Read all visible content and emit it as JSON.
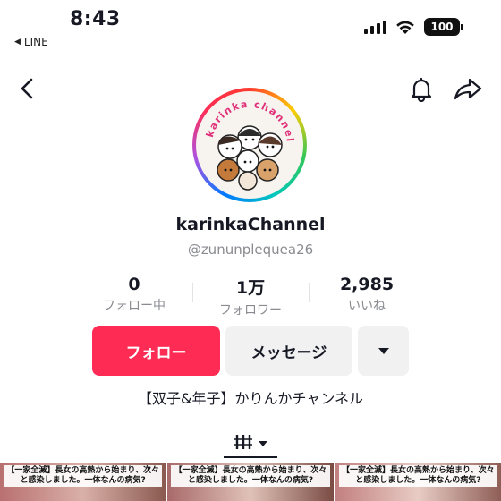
{
  "status_bar": {
    "time": "8:43",
    "back_app": "LINE",
    "battery": "100"
  },
  "profile": {
    "avatar_text": "karinka channel",
    "username": "karinkaChannel",
    "handle": "@zununplequea26",
    "bio": "【双子&年子】かりんかチャンネル"
  },
  "stats": {
    "following": {
      "value": "0",
      "label": "フォロー中"
    },
    "followers": {
      "value": "1万",
      "label": "フォロワー"
    },
    "likes": {
      "value": "2,985",
      "label": "いいね"
    }
  },
  "actions": {
    "follow": "フォロー",
    "message": "メッセージ"
  },
  "videos": [
    {
      "caption": "【一家全滅】長女の高熱から始まり、次々と感染しました。一体なんの病気?"
    },
    {
      "caption": "【一家全滅】長女の高熱から始まり、次々と感染しました。一体なんの病気?"
    },
    {
      "caption": "【一家全滅】長女の高熱から始まり、次々と感染しました。一体なんの病気?"
    }
  ],
  "colors": {
    "follow_button": "#fe2c55",
    "secondary_button": "#f1f1f2",
    "muted_text": "#8a8b91"
  },
  "icons": [
    "back-chevron-icon",
    "bell-icon",
    "share-arrow-icon",
    "dropdown-caret-icon",
    "video-grid-icon",
    "signal-icon",
    "wifi-icon"
  ]
}
